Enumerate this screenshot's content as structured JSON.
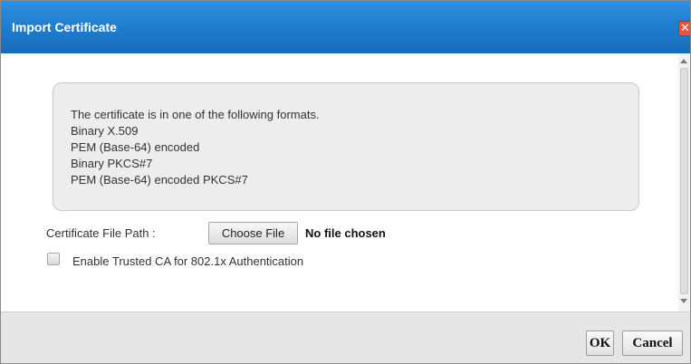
{
  "dialog": {
    "title": "Import Certificate",
    "close_symbol": "✕",
    "close_icon": "close-icon"
  },
  "info": {
    "intro": "The certificate is in one of the following formats.",
    "formats": [
      "Binary X.509",
      "PEM (Base-64) encoded",
      "Binary PKCS#7",
      "PEM (Base-64) encoded PKCS#7"
    ]
  },
  "file": {
    "label": "Certificate File Path :",
    "button_label": "Choose File",
    "status": "No file chosen"
  },
  "trusted_ca": {
    "label": "Enable Trusted CA for 802.1x Authentication",
    "checked": false
  },
  "buttons": {
    "ok": "OK",
    "cancel": "Cancel"
  },
  "colors": {
    "titlebar": "#1f7bcc",
    "close_button": "#e2563d",
    "info_box": "#ededed",
    "footer": "#e6e6e6"
  }
}
